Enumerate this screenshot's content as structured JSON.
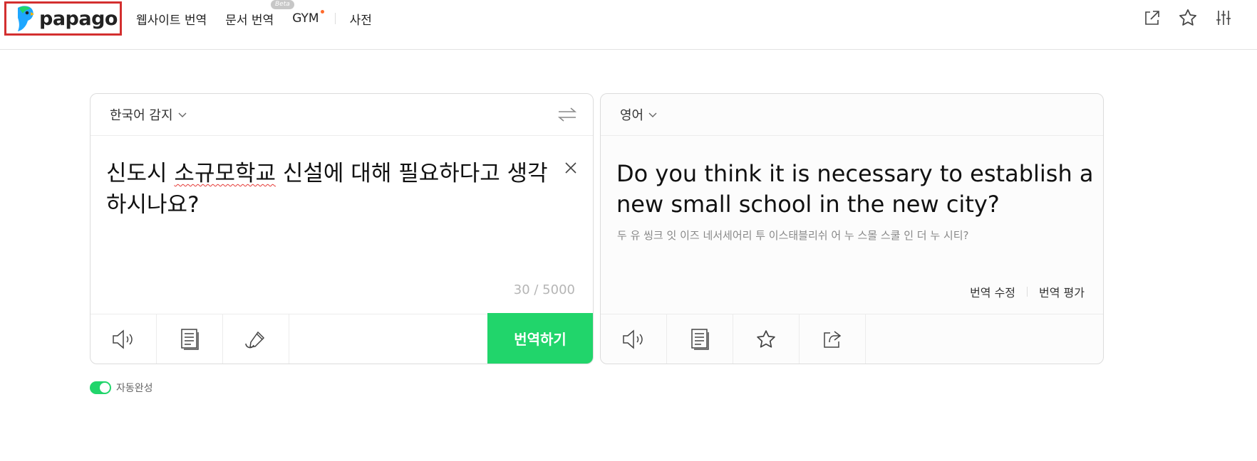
{
  "header": {
    "logo_text": "papago",
    "nav": {
      "website": "웹사이트 번역",
      "document": "문서 번역",
      "document_badge": "Beta",
      "gym": "GYM",
      "dictionary": "사전"
    },
    "icons": [
      "external-link-icon",
      "star-icon",
      "settings-sliders-icon"
    ]
  },
  "source": {
    "language": "한국어 감지",
    "text_misspelled_prefix": "신도시 ",
    "text_misspelled": "소규모학교",
    "text_rest": " 신설에 대해 필요하다고 생각하시나요?",
    "counter": "30 / 5000",
    "translate_button": "번역하기"
  },
  "target": {
    "language": "영어",
    "text": "Do you think it is necessary to establish a new small school in the new city?",
    "pronunciation": "두 유 씽크 잇 이즈 네서세어리 투 이스태블리쉬 어 누 스몰 스쿨 인 더 누 시티?",
    "edit_link": "번역 수정",
    "rate_link": "번역 평가"
  },
  "autocomplete": {
    "label": "자동완성",
    "enabled": true
  },
  "colors": {
    "accent": "#21d56b",
    "highlight_box": "#d32f2f"
  }
}
